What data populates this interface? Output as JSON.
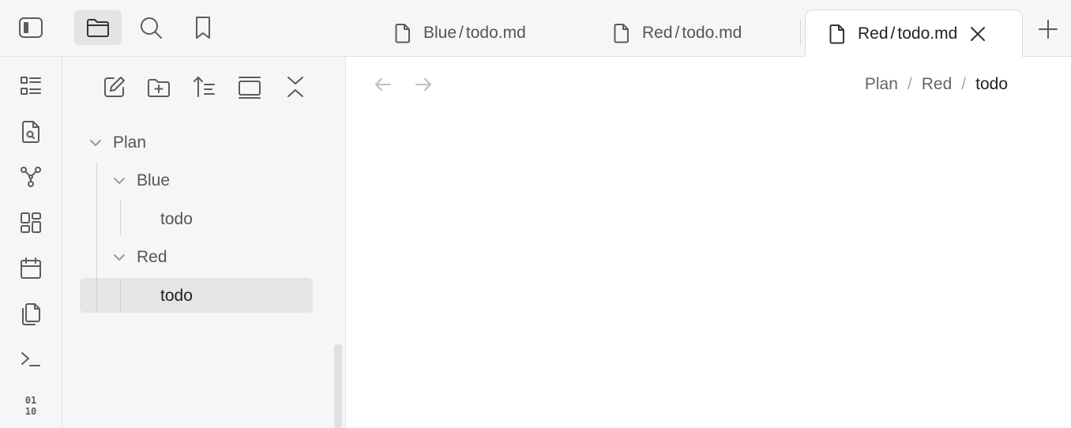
{
  "header": {
    "buttons": [
      {
        "name": "sidebar-toggle",
        "icon": "sidebar-toggle-icon"
      },
      {
        "name": "files",
        "icon": "folder-icon",
        "active": true
      },
      {
        "name": "search",
        "icon": "search-icon"
      },
      {
        "name": "bookmarks",
        "icon": "bookmark-icon"
      }
    ]
  },
  "ribbon": {
    "items": [
      "outline-icon",
      "file-search-icon",
      "graph-icon",
      "dashboard-icon",
      "calendar-icon",
      "copy-icon",
      "terminal-icon",
      "binary-icon"
    ]
  },
  "sidebar": {
    "nav_actions": [
      "new-note-icon",
      "new-folder-icon",
      "sort-icon",
      "collapse-view-icon",
      "collapse-all-icon"
    ],
    "tree": {
      "root": "Plan",
      "blue_folder": "Blue",
      "blue_todo": "todo",
      "red_folder": "Red",
      "red_todo": "todo"
    }
  },
  "tabs": [
    {
      "folder": "Blue",
      "sep": "/",
      "file": "todo.md"
    },
    {
      "folder": "Red",
      "sep": "/",
      "file": "todo.md"
    },
    {
      "folder": "Red",
      "sep": "/",
      "file": "todo.md",
      "active": true
    }
  ],
  "breadcrumb": {
    "items": [
      "Plan",
      "Red",
      "todo"
    ],
    "separator": "/"
  },
  "colors": {
    "sidebar_bg": "#f6f6f6",
    "active_row": "#e5e5e5",
    "border": "#e3e3e3",
    "icon": "#5c5c5c"
  }
}
